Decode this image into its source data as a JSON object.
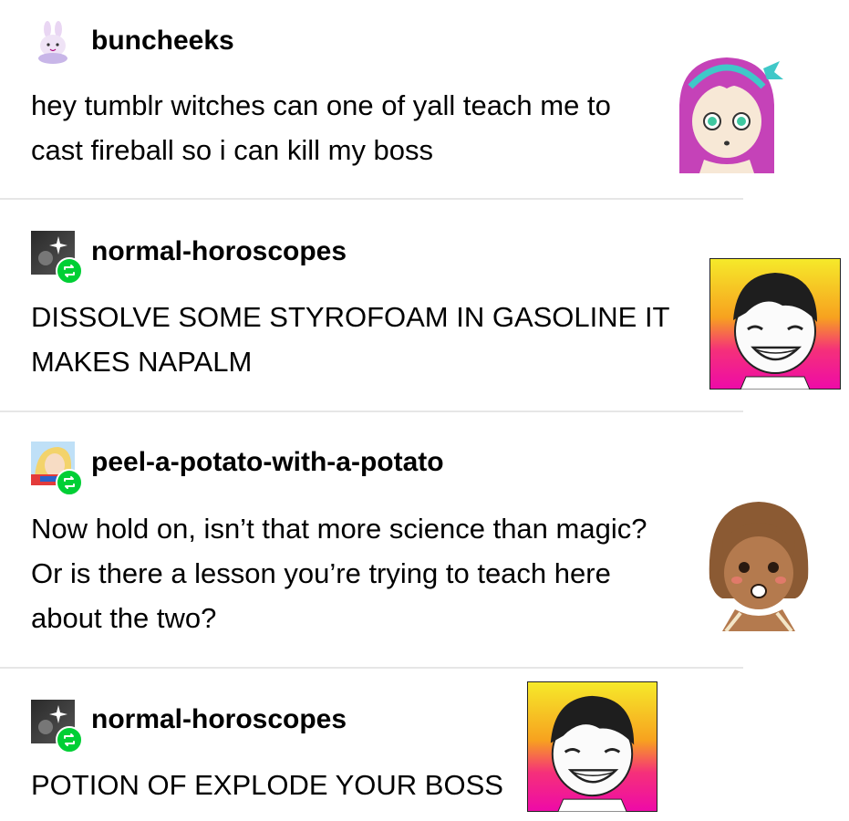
{
  "posts": [
    {
      "username": "buncheeks",
      "avatar_icon": "bunny-avatar-icon",
      "reblog": false,
      "lines": [
        "hey tumblr witches can one of yall teach me to",
        "cast fireball so i can kill my boss"
      ],
      "image": "pink-haired-character-image"
    },
    {
      "username": "normal-horoscopes",
      "avatar_icon": "dark-sparkle-avatar-icon",
      "reblog": true,
      "lines": [
        "DISSOLVE SOME STYROFOAM IN GASOLINE IT",
        "MAKES NAPALM"
      ],
      "image": "grinning-character-glitch-image"
    },
    {
      "username": "peel-a-potato-with-a-potato",
      "avatar_icon": "blonde-hero-avatar-icon",
      "reblog": true,
      "lines": [
        "Now hold on, isn’t that more science than magic?",
        "Or is there a lesson you’re trying to teach here",
        "about the two?"
      ],
      "image": "brown-haired-character-image"
    },
    {
      "username": "normal-horoscopes",
      "avatar_icon": "dark-sparkle-avatar-icon",
      "reblog": true,
      "lines": [
        "POTION OF EXPLODE YOUR BOSS"
      ],
      "image": "grinning-character-glitch-image"
    }
  ],
  "colors": {
    "reblog_badge": "#00cf35",
    "divider": "#e6e6e6",
    "text": "#000000"
  }
}
